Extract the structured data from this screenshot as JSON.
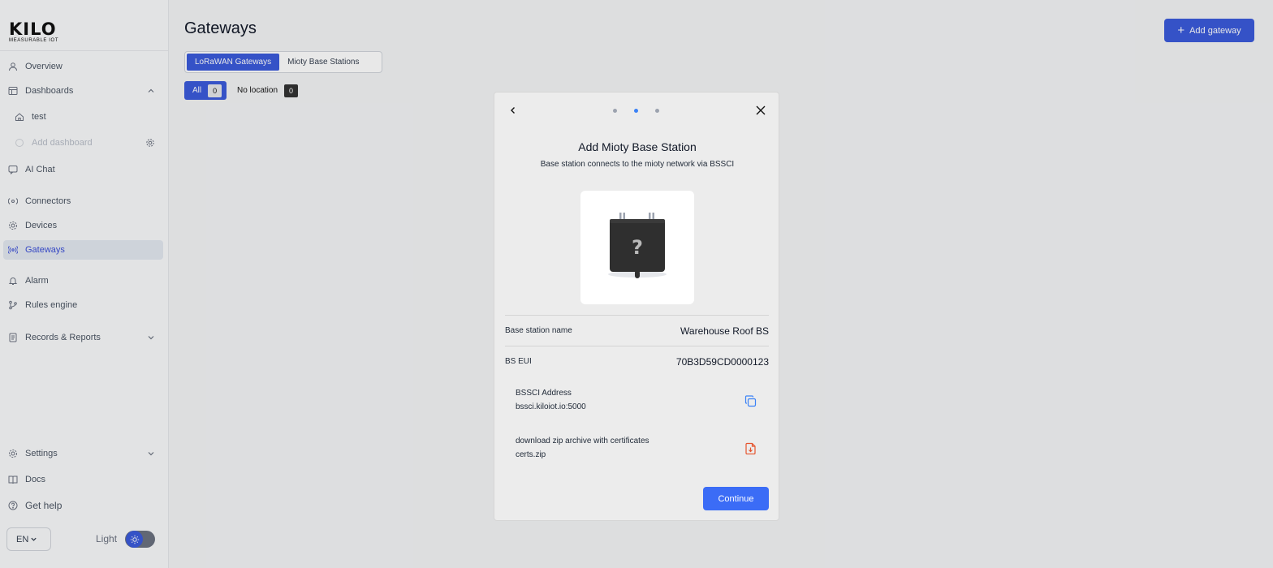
{
  "brand": {
    "logo_text": "KILO",
    "logo_sub": "MEASURABLE IOT"
  },
  "sidebar": {
    "items": [
      {
        "label": "Overview"
      },
      {
        "label": "Dashboards"
      },
      {
        "label": "test"
      },
      {
        "label": "Add dashboard"
      },
      {
        "label": "AI Chat"
      },
      {
        "label": "Connectors"
      },
      {
        "label": "Devices"
      },
      {
        "label": "Gateways"
      },
      {
        "label": "Alarm"
      },
      {
        "label": "Rules engine"
      },
      {
        "label": "Records & Reports"
      },
      {
        "label": "Settings"
      },
      {
        "label": "Docs"
      },
      {
        "label": "Get help"
      }
    ],
    "language": "EN",
    "theme_label": "Light"
  },
  "header": {
    "title": "Gateways",
    "add_button": "Add gateway"
  },
  "tabs": [
    {
      "label": "LoRaWAN Gateways"
    },
    {
      "label": "Mioty Base Stations"
    }
  ],
  "filters": [
    {
      "label": "All",
      "count": "0"
    },
    {
      "label": "No location",
      "count": "0"
    }
  ],
  "modal": {
    "title": "Add Mioty Base Station",
    "subtitle": "Base station connects to the mioty network via BSSCI",
    "device_glyph": "?",
    "fields": [
      {
        "label": "Base station name",
        "value": "Warehouse Roof BS"
      },
      {
        "label": "BS EUI",
        "value": "70B3D59CD0000123"
      }
    ],
    "bssci": {
      "label": "BSSCI Address",
      "value": "bssci.kiloiot.io:5000"
    },
    "certs": {
      "label": "download zip archive with certificates",
      "value": "certs.zip"
    },
    "continue_label": "Continue"
  },
  "colors": {
    "accent": "#3b5bdb",
    "primary_button": "#3b6cf6",
    "dot_active": "#3b82f6",
    "file_icon": "#e5532d"
  }
}
